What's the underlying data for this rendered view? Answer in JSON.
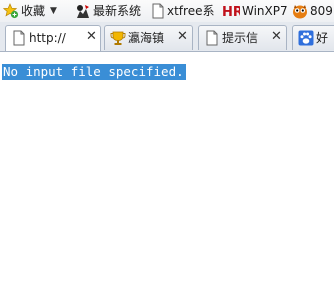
{
  "bookmarks_bar": {
    "favorites_label": "收藏",
    "items": [
      {
        "label": "最新系统",
        "icon": "system-icon"
      },
      {
        "label": "xtfree系",
        "icon": "page-icon"
      },
      {
        "label": "WinXP7",
        "icon": "hr-logo-icon"
      },
      {
        "label": "809",
        "icon": "owl-icon"
      }
    ]
  },
  "tabs": [
    {
      "label": "http://",
      "icon": "page-icon",
      "active": true
    },
    {
      "label": "瀛海镇",
      "icon": "trophy-icon",
      "active": false
    },
    {
      "label": "提示信",
      "icon": "page-icon",
      "active": false
    },
    {
      "label": "好",
      "icon": "paw-icon",
      "active": false
    }
  ],
  "page": {
    "message": "No input file specified."
  },
  "colors": {
    "selection": "#3a8ed6",
    "tab_border": "#a9b4c4"
  }
}
